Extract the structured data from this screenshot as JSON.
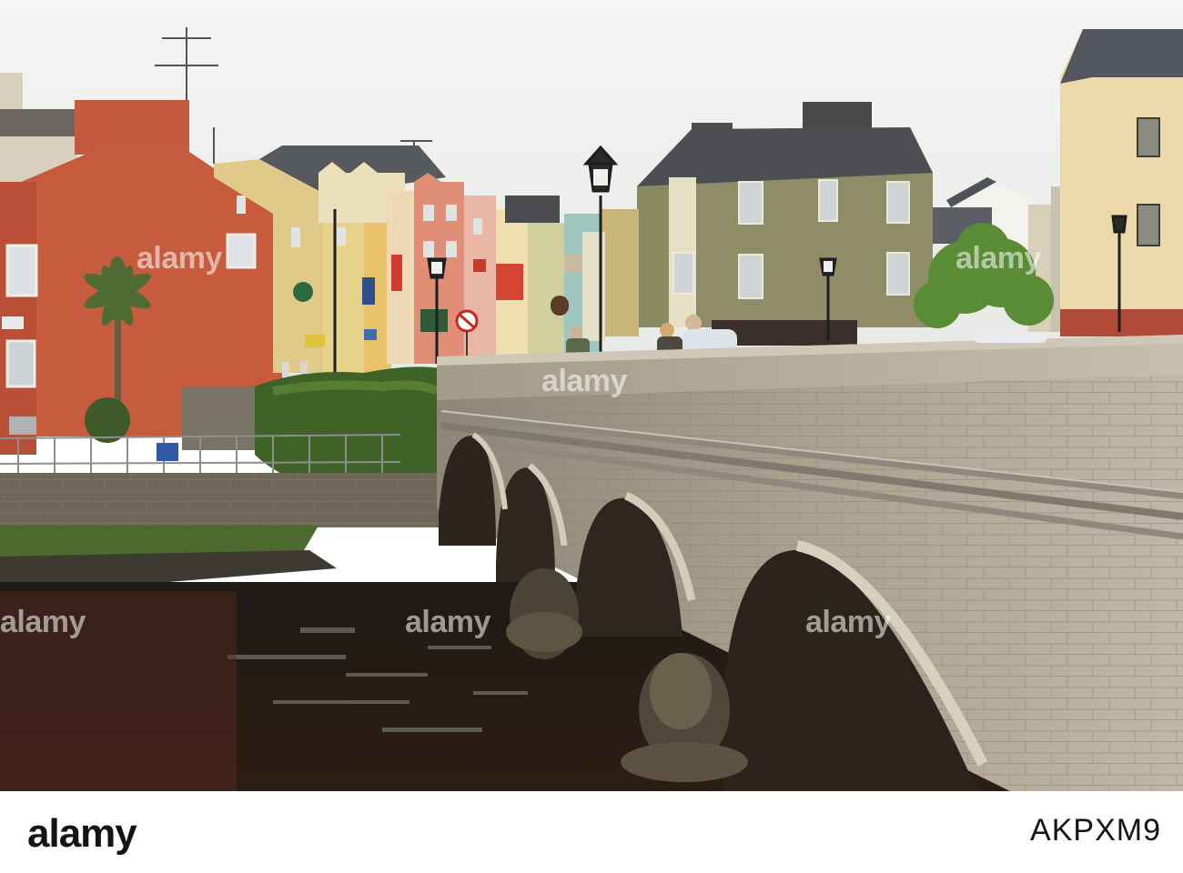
{
  "image": {
    "description_icon": "river-bridge-town-photo-icon",
    "colors": {
      "sky": "#eef0f0",
      "water": "#2a1d15",
      "bridge": "#b2a995",
      "grass": "#4d6a2e",
      "red_building": "#c95a3c"
    }
  },
  "watermarks": {
    "text": "alamy"
  },
  "footer": {
    "logo": "alamy",
    "image_id": "AKPXM9"
  }
}
